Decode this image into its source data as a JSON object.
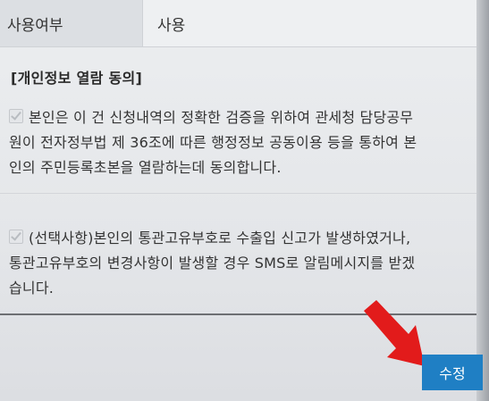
{
  "usage": {
    "label": "사용여부",
    "value": "사용"
  },
  "privacy": {
    "title": "[개인정보 열람 동의]",
    "consent_1": {
      "lines": [
        "본인은 이 건 신청내역의 정확한 검증을 위하여 관세청 담당공무",
        "원이 전자정부법 제 36조에 따른 행정정보 공동이용 등을 통하여 본",
        "인의 주민등록초본을 열람하는데 동의합니다."
      ],
      "checked": true
    },
    "consent_2": {
      "lines": [
        "(선택사항)본인의 통관고유부호로 수출입 신고가 발생하였거나,",
        "통관고유부호의 변경사항이 발생할 경우 SMS로 알림메시지를 받겠",
        "습니다."
      ],
      "checked": true
    }
  },
  "actions": {
    "modify_label": "수정"
  },
  "colors": {
    "button": "#1f7fc4",
    "arrow": "#e21b1b"
  },
  "icons": {
    "checkbox": "checkbox-icon",
    "pointer": "red-arrow-icon"
  }
}
